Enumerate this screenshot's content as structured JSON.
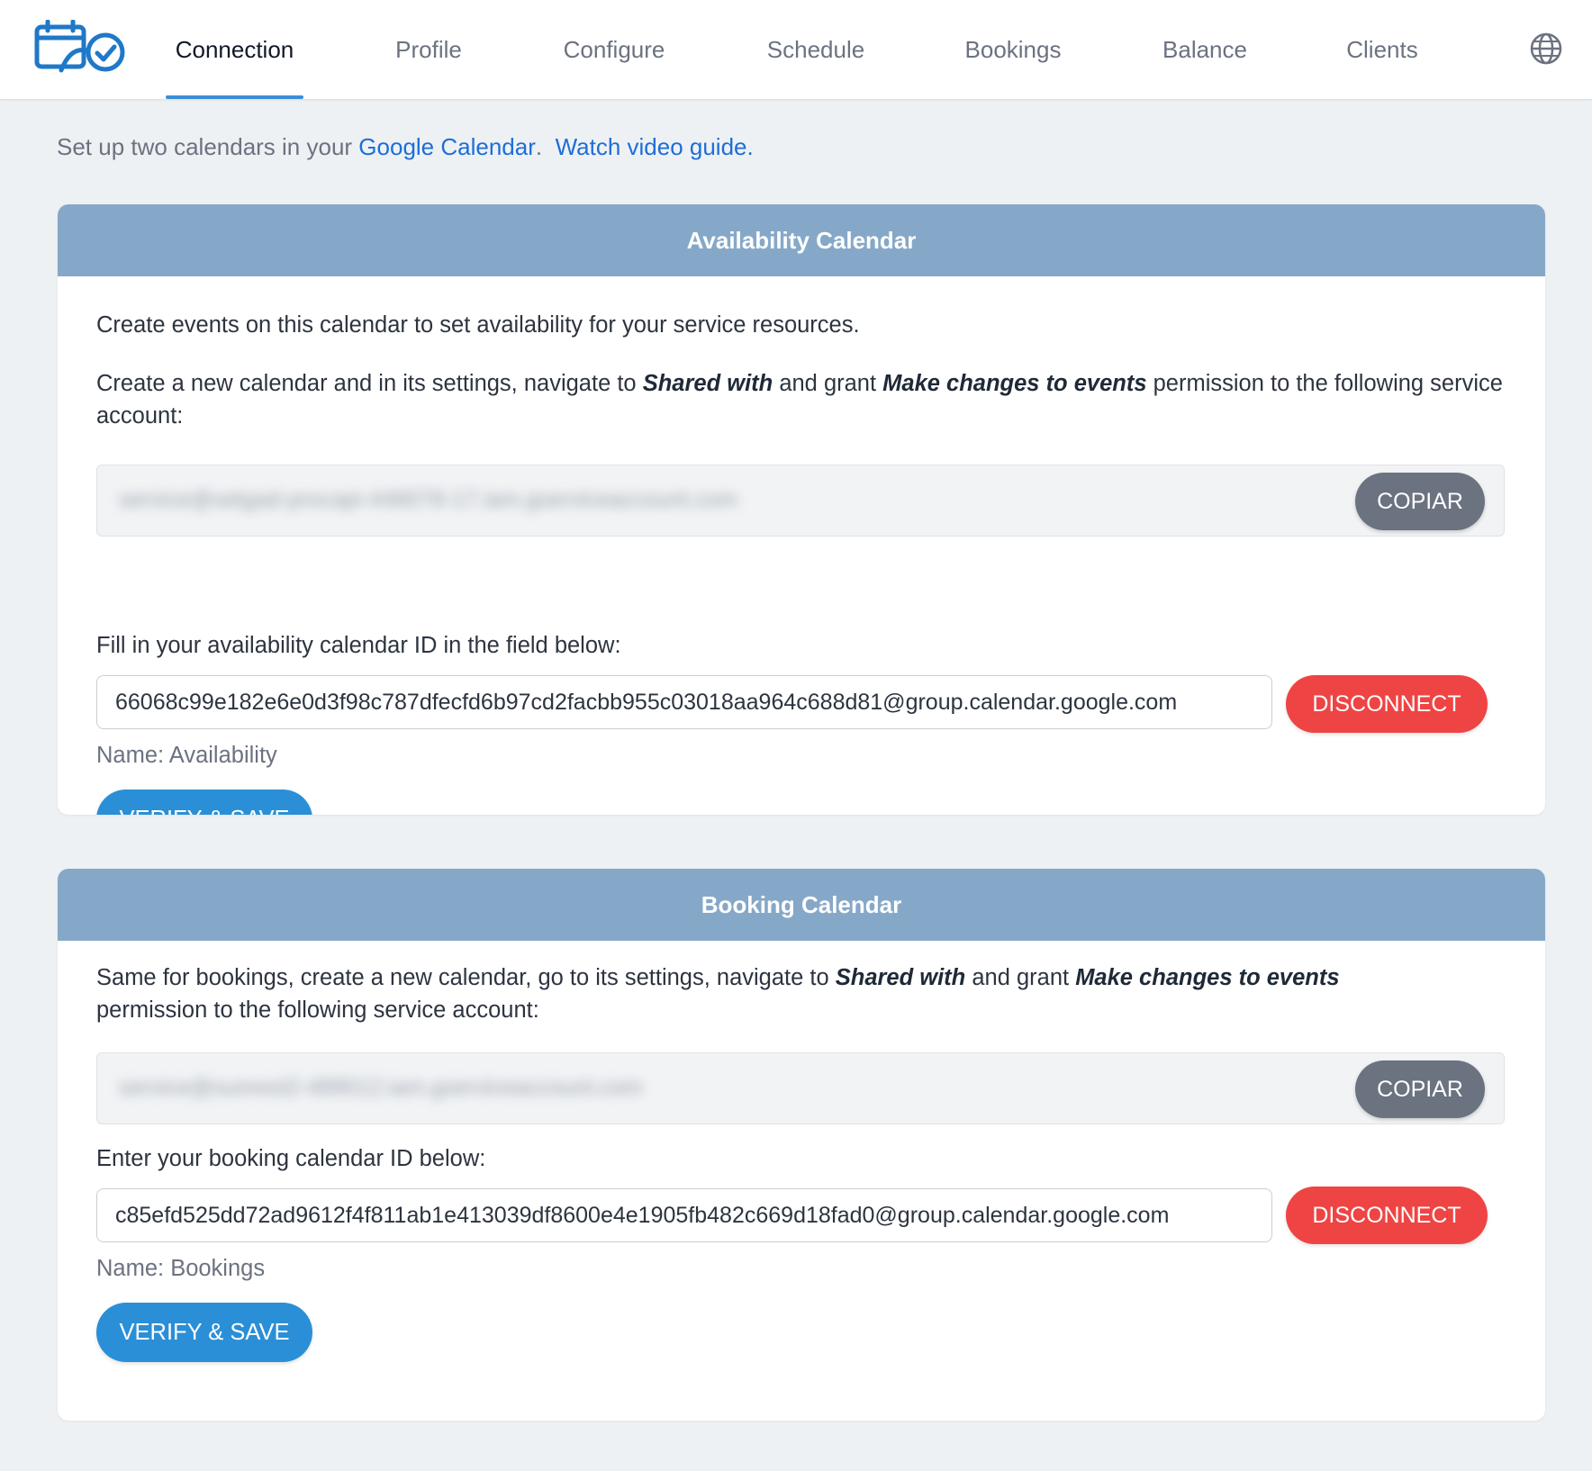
{
  "nav": {
    "logo_icon": "calendar-check-icon",
    "tabs": [
      {
        "label": "Connection",
        "active": true
      },
      {
        "label": "Profile",
        "active": false
      },
      {
        "label": "Configure",
        "active": false
      },
      {
        "label": "Schedule",
        "active": false
      },
      {
        "label": "Bookings",
        "active": false
      },
      {
        "label": "Balance",
        "active": false
      },
      {
        "label": "Clients",
        "active": false
      }
    ],
    "language_icon": "globe-icon"
  },
  "intro": {
    "prefix": "Set up two calendars in your ",
    "google_link": "Google Calendar",
    "period": ".",
    "video_link": "Watch video guide."
  },
  "availability": {
    "title": "Availability Calendar",
    "description": "Create events on this calendar to set availability for your service resources.",
    "instruction_a": "Create a new calendar and in its settings, navigate to ",
    "instruction_b": "Shared with",
    "instruction_c": " and grant ",
    "instruction_d": "Make changes to events",
    "instruction_e": " permission to the following service account:",
    "service_account": "service@setgad-procapi-448078-17.iam.gserviceaccount.com",
    "copy_label": "COPIAR",
    "id_label": "Fill in your availability calendar ID in the field below:",
    "calendar_id": "66068c99e182e6e0d3f98c787dfecfd6b97cd2facbb955c03018aa964c688d81@group.calendar.google.com",
    "disconnect_label": "DISCONNECT",
    "name_line": "Name: Availability",
    "verify_label": "VERIFY & SAVE"
  },
  "booking": {
    "title": "Booking Calendar",
    "instruction_a": "Same for bookings, create a new calendar, go to its settings, navigate to ",
    "instruction_b": "Shared with",
    "instruction_c": " and grant ",
    "instruction_d": "Make changes to events",
    "instruction_e": " permission to the following service account:",
    "service_account": "service@sunrest2-489012.iam.gserviceaccount.com",
    "copy_label": "COPIAR",
    "id_label": "Enter your booking calendar ID below:",
    "calendar_id": "c85efd525dd72ad9612f4f811ab1e413039df8600e4e1905fb482c669d18fad0@group.calendar.google.com",
    "disconnect_label": "DISCONNECT",
    "name_line": "Name: Bookings",
    "verify_label": "VERIFY & SAVE"
  },
  "colors": {
    "header_blue": "#86a8c8",
    "link_blue": "#1d6ed8",
    "verify_blue": "#2a8fd6",
    "disconnect_red": "#ef4444",
    "copy_gray": "#6b7280"
  }
}
